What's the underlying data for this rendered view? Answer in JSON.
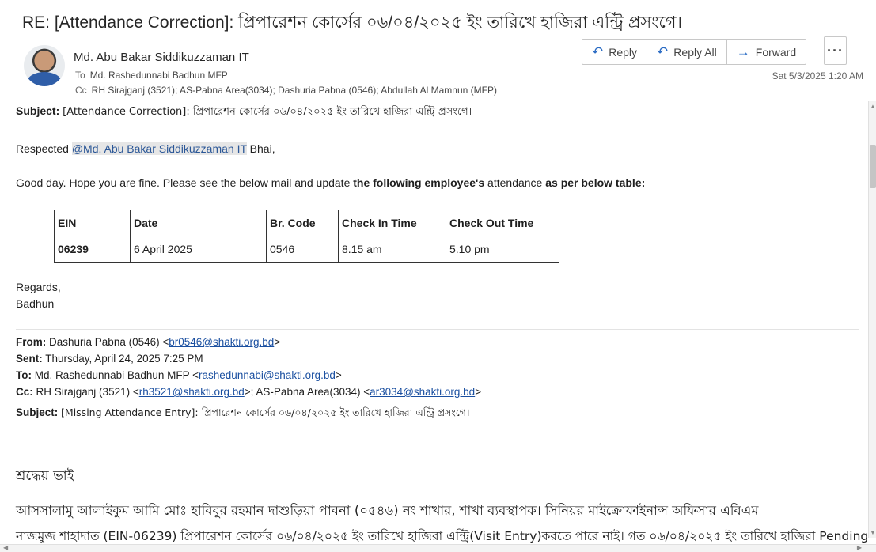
{
  "email": {
    "title": "RE: [Attendance Correction]: প্রিপারেশন কোর্সের ০৬/০৪/২০২৫ ইং তারিখে হাজিরা এন্ট্রি প্রসংগে।",
    "sender": "Md. Abu Bakar Siddikuzzaman IT",
    "to_label": "To",
    "to": "Md. Rashedunnabi Badhun MFP",
    "cc_label": "Cc",
    "cc": "RH Sirajganj (3521); AS-Pabna Area(3034); Dashuria Pabna (0546); Abdullah Al Mamnun (MFP)",
    "timestamp": "Sat 5/3/2025 1:20 AM"
  },
  "actions": {
    "reply": "Reply",
    "reply_all": "Reply All",
    "forward": "Forward",
    "more": "···"
  },
  "body": {
    "subject_label": "Subject:",
    "subject_text": "[Attendance Correction]: প্রিপারেশন কোর্সের ০৬/০৪/২০২৫ ইং তারিখে হাজিরা এন্ট্রি প্রসংগে।",
    "greeting_prefix": "Respected ",
    "mention": "@Md. Abu Bakar Siddikuzzaman IT",
    "greeting_suffix": " Bhai,",
    "para1_a": "Good day. Hope you are fine. Please see the below mail and update ",
    "para1_b": "the following employee's",
    "para1_c": " attendance ",
    "para1_d": "as per below table:",
    "table": {
      "headers": [
        "EIN",
        "Date",
        "Br. Code",
        "Check In Time",
        "Check Out Time"
      ],
      "rows": [
        [
          "06239",
          "6 April 2025",
          "0546",
          "8.15 am",
          "5.10 pm"
        ]
      ]
    },
    "regards": "Regards,",
    "sign": "Badhun"
  },
  "forwarded": {
    "from_label": "From:",
    "from_text": "Dashuria Pabna (0546) <",
    "from_email": "br0546@shakti.org.bd",
    "sent_label": "Sent:",
    "sent_text": "Thursday, April 24, 2025 7:25 PM",
    "to_label": "To:",
    "to_text": "Md. Rashedunnabi Badhun MFP <",
    "to_email": "rashedunnabi@shakti.org.bd",
    "cc_label": "Cc:",
    "cc_text1": "RH Sirajganj (3521) <",
    "cc_email1": "rh3521@shakti.org.bd",
    "cc_text2": ">; AS-Pabna Area(3034) <",
    "cc_email2": "ar3034@shakti.org.bd",
    "subject_label": "Subject:",
    "subject_text": "[Missing Attendance Entry]: প্রিপারেশন কোর্সের ০৬/০৪/২০২৫ ইং তারিখে হাজিরা এন্ট্রি প্রসংগে।",
    "salutation": "শ্রদ্ধেয় ভাই",
    "line1": "আসসালামু আলাইকুম আমি মোঃ হাবিবুর রহমান দাশুড়িয়া পাবনা (০৫৪৬) নং শাখার, শাখা ব্যবস্থাপক। সিনিয়র মাইক্রোফাইনান্স অফিসার এবিএম",
    "line2": "নাজমুজ শাহাদাত (EIN-06239) প্রিপারেশন কোর্সের ০৬/০৪/২০২৫ ইং তারিখে হাজিরা এন্ট্রি(Visit Entry)করতে পারে নাই। গত ০৬/০৪/২০২৫ ইং তারিখে হাজিরা Pending"
  },
  "colors": {
    "accent": "#2b6cc4",
    "link": "#1a4fa0",
    "mention_bg": "#e6e6e6"
  }
}
